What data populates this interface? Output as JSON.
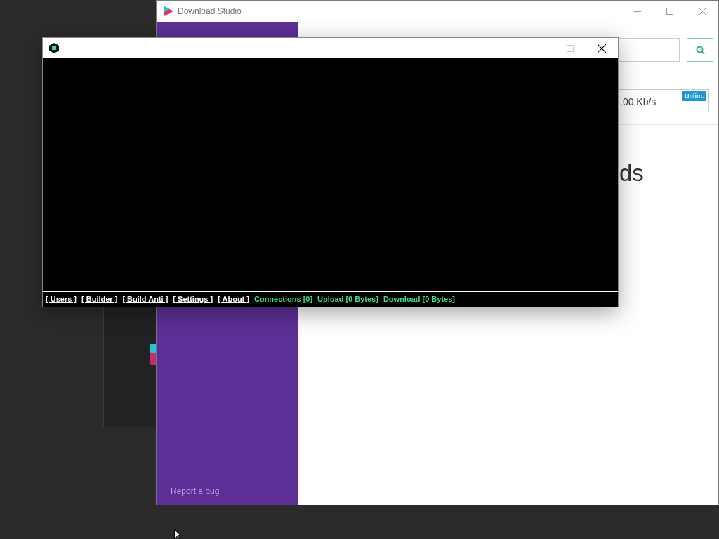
{
  "download_studio": {
    "title": "Download Studio",
    "footer_link": "Report a bug",
    "speed_reading": ".00 Kb/s",
    "speed_badge": "Unlim.",
    "heading": "ds"
  },
  "console_window": {
    "maximize": {
      "disabled": true
    },
    "status_items": [
      {
        "label": "[ Users ]",
        "kind": "link"
      },
      {
        "label": "[ Builder ]",
        "kind": "link"
      },
      {
        "label": "[ Build Anti ]",
        "kind": "link"
      },
      {
        "label": "[ Settings ]",
        "kind": "link"
      },
      {
        "label": "[ About ]",
        "kind": "link"
      },
      {
        "label": "Connections [0]",
        "kind": "stat"
      },
      {
        "label": "Upload [0 Bytes]",
        "kind": "stat"
      },
      {
        "label": "Download [0 Bytes]",
        "kind": "stat"
      }
    ]
  }
}
